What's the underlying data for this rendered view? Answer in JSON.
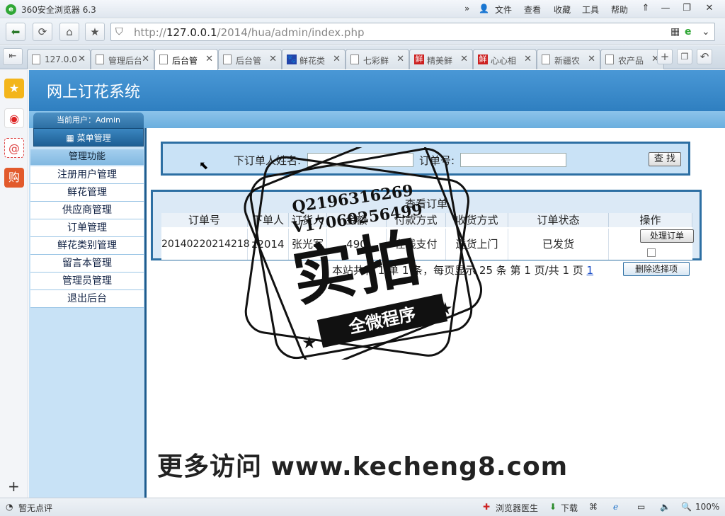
{
  "window": {
    "title": "360安全浏览器 6.3",
    "menu": [
      "文件",
      "查看",
      "收藏",
      "工具",
      "帮助"
    ],
    "controls": [
      "⇑",
      "—",
      "❐",
      "✕"
    ]
  },
  "address": {
    "scheme": "http://",
    "host": "127.0.0.1",
    "path": "/2014/hua/admin/index.php"
  },
  "tabs": [
    {
      "label": "127.0.0",
      "icon": "doc"
    },
    {
      "label": "管理后台",
      "icon": "doc"
    },
    {
      "label": "后台管",
      "icon": "doc",
      "active": true
    },
    {
      "label": "后台管",
      "icon": "doc"
    },
    {
      "label": "鲜花类",
      "icon": "paw",
      "glyph": "🐾"
    },
    {
      "label": "七彩鲜",
      "icon": "doc"
    },
    {
      "label": "精美鲜",
      "icon": "red",
      "glyph": "鲜"
    },
    {
      "label": "心心相",
      "icon": "red",
      "glyph": "鲜"
    },
    {
      "label": "新疆农",
      "icon": "doc"
    },
    {
      "label": "农产品",
      "icon": "doc"
    }
  ],
  "site": {
    "title": "网上订花系统",
    "current_user": "当前用户：Admin",
    "menu_title": "菜单管理",
    "menu_head": "管理功能",
    "menu_items": [
      "注册用户管理",
      "鲜花管理",
      "供应商管理",
      "订单管理",
      "鲜花类别管理",
      "留言本管理",
      "管理员管理",
      "退出后台"
    ]
  },
  "search": {
    "name_label": "下订单人姓名:",
    "name_value": "",
    "order_label": "订单号:",
    "order_value": "",
    "button": "查 找"
  },
  "orders": {
    "caption": "查看订单",
    "columns": [
      "订单号",
      "下单人",
      "订货人",
      "金额",
      "付款方式",
      "收货方式",
      "订单状态",
      "操作"
    ],
    "rows": [
      {
        "id": "20140220214218",
        "user": "z2014",
        "receiver": "张光军",
        "amount": "490",
        "pay": "在线支付",
        "ship": "送货上门",
        "status": "已发货",
        "action": "处理订单"
      }
    ]
  },
  "pager": {
    "text": "本站共有 1 单 1 条，每页显示 25 条 第 1 页/共 1 页",
    "link": "1",
    "delete_button": "删除选择项"
  },
  "watermark": {
    "qq1": "Q2196316269",
    "qq2": "V17060256499",
    "big": "实拍",
    "ribbon": "全微程序",
    "ad_prefix": "更多访问",
    "ad_url": "www.kecheng8.com"
  },
  "statusbar": {
    "left": "暂无点评",
    "doctor": "浏览器医生",
    "download": "下载",
    "zoom": "100%"
  },
  "colors": {
    "header_blue": "#2f7fc0",
    "menu_bg": "#c8e2f6",
    "border_blue": "#2d6fa3"
  }
}
